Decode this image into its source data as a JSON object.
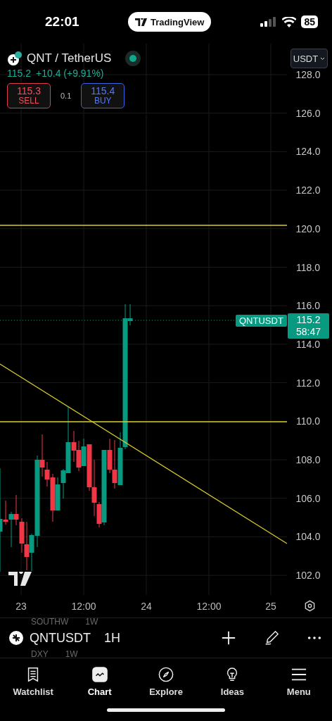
{
  "status_bar": {
    "time": "22:01",
    "app_badge": "TradingView",
    "battery": "85"
  },
  "header": {
    "title": "QNT / TetherUS",
    "live": true,
    "price": "115.2",
    "change": "+10.4 (+9.91%)",
    "sell": {
      "price": "115.3",
      "label": "SELL"
    },
    "spread": "0.1",
    "buy": {
      "price": "115.4",
      "label": "BUY"
    }
  },
  "currency_button": "USDT",
  "price_axis": [
    "128.0",
    "126.0",
    "124.0",
    "122.0",
    "120.0",
    "118.0",
    "116.0",
    "114.0",
    "112.0",
    "110.0",
    "108.0",
    "106.0",
    "104.0",
    "102.0"
  ],
  "price_label": {
    "symbol": "QNTUSDT",
    "price": "115.2",
    "countdown": "58:47"
  },
  "time_axis": [
    "23",
    "12:00",
    "24",
    "12:00",
    "25"
  ],
  "background_rows": [
    {
      "symbol": "SOUTHW",
      "interval": "1W"
    },
    {
      "symbol": "DXY",
      "interval": "1W"
    }
  ],
  "symbol_bar": {
    "symbol": "QNTUSDT",
    "interval": "1H"
  },
  "tabs": [
    {
      "label": "Watchlist",
      "selected": false
    },
    {
      "label": "Chart",
      "selected": true
    },
    {
      "label": "Explore",
      "selected": false
    },
    {
      "label": "Ideas",
      "selected": false
    },
    {
      "label": "Menu",
      "selected": false
    }
  ]
}
